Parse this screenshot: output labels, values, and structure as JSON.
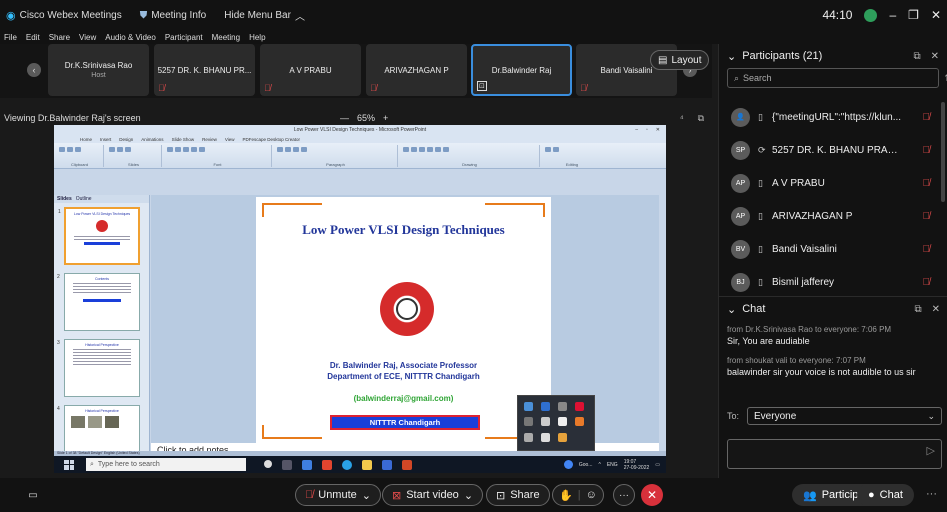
{
  "titlebar": {
    "app_name": "Cisco Webex Meetings",
    "meeting_info": "Meeting Info",
    "hide_menu": "Hide Menu Bar",
    "timer": "44:10",
    "minimize": "–",
    "maximize": "❐",
    "close": "✕"
  },
  "menubar": [
    "File",
    "Edit",
    "Share",
    "View",
    "Audio & Video",
    "Participant",
    "Meeting",
    "Help"
  ],
  "strip": {
    "tiles": [
      {
        "name": "Dr.K.Srinivasa Rao",
        "sub": "Host",
        "muted": false,
        "active": false
      },
      {
        "name": "5257 DR. K. BHANU PR...",
        "sub": "",
        "muted": true,
        "active": false
      },
      {
        "name": "A V PRABU",
        "sub": "",
        "muted": true,
        "active": false
      },
      {
        "name": "ARIVAZHAGAN P",
        "sub": "",
        "muted": true,
        "active": false
      },
      {
        "name": "Dr.Balwinder Raj",
        "sub": "",
        "muted": false,
        "active": true
      },
      {
        "name": "Bandi Vaisalini",
        "sub": "",
        "muted": true,
        "active": false
      }
    ],
    "layout_label": "Layout"
  },
  "viewbar": {
    "viewing": "Viewing Dr.Balwinder Raj's screen",
    "zoom_out": "—",
    "zoom": "65%",
    "zoom_in": "+"
  },
  "ppt": {
    "title": "Low Power VLSI Design Techniques - Microsoft PowerPoint",
    "tabs": [
      "Home",
      "Insert",
      "Design",
      "Animations",
      "Slide Show",
      "Review",
      "View",
      "PDFescape Desktop Creator"
    ],
    "groups": [
      "Clipboard",
      "Slides",
      "Font",
      "Paragraph",
      "Drawing",
      "Editing"
    ],
    "left_tabs": [
      "Slides",
      "Outline"
    ],
    "thumbs": [
      {
        "num": "1",
        "title": "Low Power VLSI Design Techniques"
      },
      {
        "num": "2",
        "title": "Contents"
      },
      {
        "num": "3",
        "title": "Historical Perspective"
      },
      {
        "num": "4",
        "title": "Historical Perspective"
      }
    ],
    "slide": {
      "heading": "Low Power VLSI Design Techniques",
      "presenter": "Dr. Balwinder Raj, Associate Professor",
      "department": "Department of ECE, NITTTR Chandigarh",
      "email": "(balwinderraj@gmail.com)",
      "banner": "NITTTR Chandigarh"
    },
    "notes": "Click to add notes",
    "status": "Slide 1 of 38   \"Default Design\"   English (United States)",
    "taskbar_search": "Type here to search",
    "tray_lang": "ENG",
    "tray_time": "19:07",
    "tray_date": "27-09-2022",
    "tray_app": "Goo..."
  },
  "participants": {
    "title": "Participants (21)",
    "search_placeholder": "Search",
    "list": [
      {
        "initials": "",
        "name": "{\"meetingURL\":\"https://klun...",
        "muted": true
      },
      {
        "initials": "SP",
        "name": "5257 DR. K. BHANU PRAKASH",
        "muted": true
      },
      {
        "initials": "AP",
        "name": "A V PRABU",
        "muted": true
      },
      {
        "initials": "AP",
        "name": "ARIVAZHAGAN P",
        "muted": true
      },
      {
        "initials": "BV",
        "name": "Bandi Vaisalini",
        "muted": true
      },
      {
        "initials": "BJ",
        "name": "Bismil jafferey",
        "muted": true
      }
    ]
  },
  "chat": {
    "title": "Chat",
    "messages": [
      {
        "meta": "from Dr.K.Srinivasa Rao to everyone:   7:06 PM",
        "text": "Sir, You are audiable"
      },
      {
        "meta": "from shoukat vali to everyone:   7:07 PM",
        "text": "balawinder sir your voice is not audible to us sir"
      }
    ],
    "to_label": "To:",
    "to_value": "Everyone"
  },
  "controls": {
    "unmute": "Unmute",
    "start_video": "Start video",
    "share": "Share",
    "participants": "Participants",
    "chat": "Chat"
  }
}
